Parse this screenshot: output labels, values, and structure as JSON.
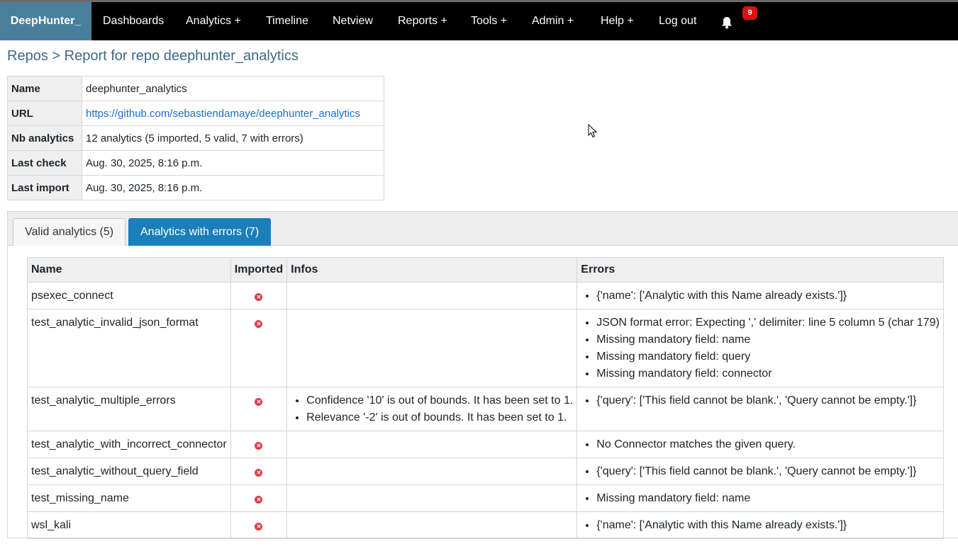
{
  "navbar": {
    "brand": "DeepHunter_",
    "items": [
      "Dashboards",
      "Analytics +",
      "Timeline",
      "Netview",
      "Reports +",
      "Tools +",
      "Admin +",
      "Help +",
      "Log out"
    ],
    "notification_count": "9"
  },
  "breadcrumb": {
    "root": "Repos",
    "separator": ">",
    "current": "Report for repo deephunter_analytics"
  },
  "repo_info": {
    "rows": [
      {
        "label": "Name",
        "value": "deephunter_analytics"
      },
      {
        "label": "URL",
        "value": "https://github.com/sebastiendamaye/deephunter_analytics"
      },
      {
        "label": "Nb analytics",
        "value": "12 analytics (5 imported, 5 valid, 7 with errors)"
      },
      {
        "label": "Last check",
        "value": "Aug. 30, 2025, 8:16 p.m."
      },
      {
        "label": "Last import",
        "value": "Aug. 30, 2025, 8:16 p.m."
      }
    ]
  },
  "tabs": {
    "valid": "Valid analytics (5)",
    "errors": "Analytics with errors (7)",
    "active": "errors"
  },
  "table": {
    "headers": [
      "Name",
      "Imported",
      "Infos",
      "Errors"
    ],
    "rows": [
      {
        "name": "psexec_connect",
        "imported": "x-icon",
        "infos": [],
        "errors": [
          "{'name': ['Analytic with this Name already exists.']}"
        ]
      },
      {
        "name": "test_analytic_invalid_json_format",
        "imported": "x-icon",
        "infos": [],
        "errors": [
          "JSON format error: Expecting ',' delimiter: line 5 column 5 (char 179)",
          "Missing mandatory field: name",
          "Missing mandatory field: query",
          "Missing mandatory field: connector"
        ]
      },
      {
        "name": "test_analytic_multiple_errors",
        "imported": "x-icon",
        "infos": [
          "Confidence '10' is out of bounds. It has been set to 1.",
          "Relevance '-2' is out of bounds. It has been set to 1."
        ],
        "errors": [
          "{'query': ['This field cannot be blank.', 'Query cannot be empty.']}"
        ]
      },
      {
        "name": "test_analytic_with_incorrect_connector",
        "imported": "x-icon",
        "infos": [],
        "errors": [
          "No Connector matches the given query."
        ]
      },
      {
        "name": "test_analytic_without_query_field",
        "imported": "x-icon",
        "infos": [],
        "errors": [
          "{'query': ['This field cannot be blank.', 'Query cannot be empty.']}"
        ]
      },
      {
        "name": "test_missing_name",
        "imported": "x-icon",
        "infos": [],
        "errors": [
          "Missing mandatory field: name"
        ]
      },
      {
        "name": "wsl_kali",
        "imported": "x-icon",
        "infos": [],
        "errors": [
          "{'name': ['Analytic with this Name already exists.']}"
        ]
      }
    ]
  },
  "colors": {
    "brand_bg": "#4a7f9b",
    "active_tab": "#1a7fba",
    "error_icon": "#d9404a",
    "badge": "#e01010",
    "link": "#1a6dca"
  }
}
